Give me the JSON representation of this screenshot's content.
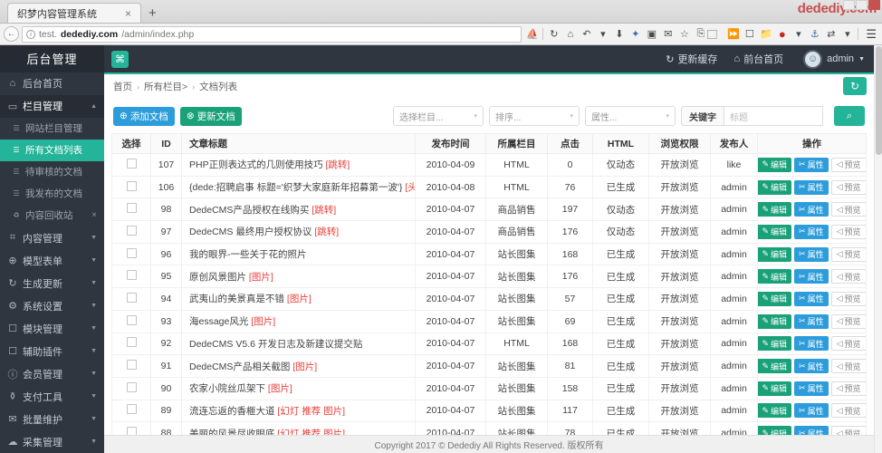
{
  "browser": {
    "tab_title": "织梦内容管理系统",
    "tab_close": "×",
    "new_tab": "+",
    "url_prefix": "test.",
    "url_host": "dedediy.com",
    "url_path": "/admin/index.php",
    "watermark": "dedediy.com",
    "back_icon": "←",
    "info_icon": "i"
  },
  "sidebar": {
    "brand": "后台管理",
    "items": [
      {
        "label": "后台首页",
        "icon": "home-icon",
        "glyph": "⌂",
        "caret": ""
      },
      {
        "label": "栏目管理",
        "icon": "folder-icon",
        "glyph": "▭",
        "caret": "▲"
      },
      {
        "label": "内容管理",
        "icon": "grid-icon",
        "glyph": "⌗",
        "caret": "▼"
      },
      {
        "label": "模型表单",
        "icon": "globe-icon",
        "glyph": "⊕",
        "caret": "▼"
      },
      {
        "label": "生成更新",
        "icon": "refresh-icon",
        "glyph": "↻",
        "caret": "▼"
      },
      {
        "label": "系统设置",
        "icon": "gear-icon",
        "glyph": "⚙",
        "caret": "▼"
      },
      {
        "label": "模块管理",
        "icon": "folder-open-icon",
        "glyph": "☐",
        "caret": "▼"
      },
      {
        "label": "辅助插件",
        "icon": "plugin-icon",
        "glyph": "☐",
        "caret": "▼"
      },
      {
        "label": "会员管理",
        "icon": "user-circle-icon",
        "glyph": "ⓘ",
        "caret": "▼"
      },
      {
        "label": "支付工具",
        "icon": "cart-icon",
        "glyph": "⚱",
        "caret": "▼"
      },
      {
        "label": "批量维护",
        "icon": "mail-icon",
        "glyph": "✉",
        "caret": "▼"
      },
      {
        "label": "采集管理",
        "icon": "cloud-icon",
        "glyph": "☁",
        "caret": "▼"
      }
    ],
    "submenu": [
      {
        "label": "网站栏目管理",
        "active": false,
        "close": ""
      },
      {
        "label": "所有文档列表",
        "active": true,
        "close": ""
      },
      {
        "label": "待审核的文档",
        "active": false,
        "close": ""
      },
      {
        "label": "我发布的文档",
        "active": false,
        "close": ""
      },
      {
        "label": "内容回收站",
        "active": false,
        "close": "×"
      }
    ]
  },
  "topbar": {
    "logo_glyph": "⌘",
    "update_cache": "更新缓存",
    "update_cache_glyph": "↻",
    "front_page": "前台首页",
    "front_page_glyph": "⌂",
    "user_name": "admin",
    "user_caret": "▼",
    "avatar_glyph": "☺"
  },
  "breadcrumb": {
    "items": [
      "首页",
      "所有栏目>",
      "文档列表"
    ],
    "separator": "›",
    "refresh_glyph": "↻"
  },
  "toolbar": {
    "add_doc": "添加文档",
    "add_doc_glyph": "⊕",
    "update_doc": "更新文档",
    "update_doc_glyph": "⊗",
    "select_column": "选择栏目...",
    "sort": "排序...",
    "attribute": "属性...",
    "keyword_label": "关键字",
    "keyword_placeholder": "标题",
    "caret": "▾",
    "search_glyph": "⌕"
  },
  "table": {
    "headers": [
      "选择",
      "ID",
      "文章标题",
      "发布时间",
      "所属栏目",
      "点击",
      "HTML",
      "浏览权限",
      "发布人",
      "操作"
    ],
    "rows": [
      {
        "id": "107",
        "title": "PHP正则表达式的几则使用技巧 ",
        "tags": "[跳转]",
        "date": "2010-04-09",
        "column": "HTML",
        "clicks": "0",
        "html": "仅动态",
        "perm": "开放浏览",
        "author": "like"
      },
      {
        "id": "106",
        "title": "{dede:招聘启事 标题='织梦大家庭新年招募第一波'} ",
        "tags": "[头条 推荐 特荐]",
        "date": "2010-04-08",
        "column": "HTML",
        "clicks": "76",
        "html": "已生成",
        "perm": "开放浏览",
        "author": "admin"
      },
      {
        "id": "98",
        "title": "DedeCMS产品授权在线购买 ",
        "tags": "[跳转]",
        "date": "2010-04-07",
        "column": "商品销售",
        "clicks": "197",
        "html": "仅动态",
        "perm": "开放浏览",
        "author": "admin"
      },
      {
        "id": "97",
        "title": "DedeCMS 最终用户授权协议 ",
        "tags": "[跳转]",
        "date": "2010-04-07",
        "column": "商品销售",
        "clicks": "176",
        "html": "仅动态",
        "perm": "开放浏览",
        "author": "admin"
      },
      {
        "id": "96",
        "title": "我的眼界-一些关于花的照片",
        "tags": "",
        "date": "2010-04-07",
        "column": "站长图集",
        "clicks": "168",
        "html": "已生成",
        "perm": "开放浏览",
        "author": "admin"
      },
      {
        "id": "95",
        "title": "原创风景图片 ",
        "tags": "[图片]",
        "date": "2010-04-07",
        "column": "站长图集",
        "clicks": "176",
        "html": "已生成",
        "perm": "开放浏览",
        "author": "admin"
      },
      {
        "id": "94",
        "title": "武夷山的美景真是不错 ",
        "tags": "[图片]",
        "date": "2010-04-07",
        "column": "站长图集",
        "clicks": "57",
        "html": "已生成",
        "perm": "开放浏览",
        "author": "admin"
      },
      {
        "id": "93",
        "title": "海essage风光 ",
        "tags": "[图片]",
        "date": "2010-04-07",
        "column": "站长图集",
        "clicks": "69",
        "html": "已生成",
        "perm": "开放浏览",
        "author": "admin"
      },
      {
        "id": "92",
        "title": "DedeCMS V5.6 开发日志及新建议提交贴",
        "tags": "",
        "date": "2010-04-07",
        "column": "HTML",
        "clicks": "168",
        "html": "已生成",
        "perm": "开放浏览",
        "author": "admin"
      },
      {
        "id": "91",
        "title": "DedeCMS产品相关截图 ",
        "tags": "[图片]",
        "date": "2010-04-07",
        "column": "站长图集",
        "clicks": "81",
        "html": "已生成",
        "perm": "开放浏览",
        "author": "admin"
      },
      {
        "id": "90",
        "title": "农家小院丝瓜架下 ",
        "tags": "[图片]",
        "date": "2010-04-07",
        "column": "站长图集",
        "clicks": "158",
        "html": "已生成",
        "perm": "开放浏览",
        "author": "admin"
      },
      {
        "id": "89",
        "title": "流连忘返的香榧大道 ",
        "tags": "[幻灯 推荐 图片]",
        "date": "2010-04-07",
        "column": "站长图集",
        "clicks": "117",
        "html": "已生成",
        "perm": "开放浏览",
        "author": "admin"
      },
      {
        "id": "88",
        "title": "美丽的风景尽收眼底 ",
        "tags": "[幻灯 推荐 图片]",
        "date": "2010-04-07",
        "column": "站长图集",
        "clicks": "78",
        "html": "已生成",
        "perm": "开放浏览",
        "author": "admin"
      }
    ],
    "ops": {
      "edit": "编辑",
      "edit_glyph": "✎",
      "attr": "属性",
      "attr_glyph": "✂",
      "preview": "预览",
      "preview_glyph": "◁"
    }
  },
  "footer": {
    "text": "Copyright 2017 © Dedediy All Rights Reserved. 版权所有"
  },
  "colors": {
    "accent": "#23b499",
    "sidebar": "#2f3640",
    "blue": "#2d9cdb",
    "green": "#1aa179",
    "tag_red": "#e8403a"
  }
}
